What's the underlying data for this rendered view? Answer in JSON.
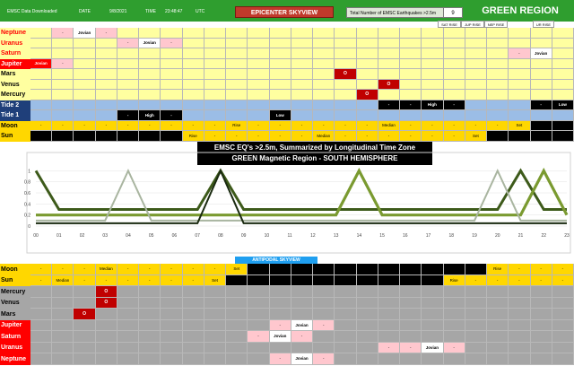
{
  "header": {
    "downloaded_label": "EMSC Data Downloaded",
    "date_label": "DATE",
    "date_value": "9/8/2021",
    "time_label": "TIME",
    "time_value": "23:48:47",
    "tz": "UTC",
    "epicenter_title": "EPICENTER SKYVIEW",
    "total_label": "Total Number of EMSC Earthquakes >2.5m",
    "total_value": "9",
    "region_title": "GREEN REGION",
    "rise_labels": [
      "SAT RISE",
      "JUP RISE",
      "NEP RISE",
      "UR RISE"
    ]
  },
  "epicenter_rows": [
    {
      "label": "Neptune",
      "label_color": "#ff0000",
      "bg": "#ffffa0",
      "label_bg": "#ffffa0",
      "cells": [
        {
          "i": 2,
          "t": "-",
          "k": "dash"
        },
        {
          "i": 3,
          "t": "Jovian",
          "k": "jov"
        },
        {
          "i": 4,
          "t": "-",
          "k": "dash"
        }
      ]
    },
    {
      "label": "Uranus",
      "label_color": "#ff0000",
      "bg": "#ffffa0",
      "label_bg": "#ffffa0",
      "cells": [
        {
          "i": 5,
          "t": "-",
          "k": "dash"
        },
        {
          "i": 6,
          "t": "Jovian",
          "k": "jov"
        },
        {
          "i": 7,
          "t": "-",
          "k": "dash"
        }
      ]
    },
    {
      "label": "Saturn",
      "label_color": "#ff0000",
      "bg": "#ffffa0",
      "label_bg": "#ffffa0",
      "cells": [
        {
          "i": 23,
          "t": "-",
          "k": "dash"
        },
        {
          "i": 24,
          "t": "Jovian",
          "k": "jov"
        }
      ]
    },
    {
      "label": "Jupiter",
      "label_color": "#ffffff",
      "bg": "#ffffa0",
      "label_bg": "#ff0000",
      "cells": [
        {
          "i": 1,
          "t": "Jovian",
          "k": "jov-red"
        },
        {
          "i": 2,
          "t": "-",
          "k": "dash"
        }
      ]
    },
    {
      "label": "Mars",
      "label_color": "#000000",
      "bg": "#ffffa0",
      "label_bg": "#ffffa0",
      "cells": [
        {
          "i": 15,
          "t": "O",
          "k": "o"
        }
      ]
    },
    {
      "label": "Venus",
      "label_color": "#000000",
      "bg": "#ffffa0",
      "label_bg": "#ffffa0",
      "cells": [
        {
          "i": 17,
          "t": "O",
          "k": "o"
        }
      ]
    },
    {
      "label": "Mercury",
      "label_color": "#000000",
      "bg": "#ffffa0",
      "label_bg": "#ffffa0",
      "cells": [
        {
          "i": 16,
          "t": "O",
          "k": "o"
        }
      ]
    },
    {
      "label": "Tide 2",
      "label_color": "#ffffff",
      "bg": "#9bbde6",
      "label_bg": "#1f3f7a",
      "cells": [
        {
          "i": 17,
          "t": "-",
          "k": "tide"
        },
        {
          "i": 18,
          "t": "-",
          "k": "tide"
        },
        {
          "i": 19,
          "t": "High",
          "k": "tide"
        },
        {
          "i": 20,
          "t": "-",
          "k": "tide"
        },
        {
          "i": 24,
          "t": "-",
          "k": "tide"
        },
        {
          "i": 25,
          "t": "Low",
          "k": "tide"
        }
      ]
    },
    {
      "label": "Tide 1",
      "label_color": "#ffffff",
      "bg": "#9bbde6",
      "label_bg": "#1f3f7a",
      "cells": [
        {
          "i": 5,
          "t": "-",
          "k": "tide"
        },
        {
          "i": 6,
          "t": "High",
          "k": "tide"
        },
        {
          "i": 7,
          "t": "-",
          "k": "tide"
        },
        {
          "i": 12,
          "t": "Low",
          "k": "tide"
        }
      ]
    },
    {
      "label": "Moon",
      "label_color": "#000000",
      "bg": "#000000",
      "label_bg": "#ffd700",
      "cells": [
        {
          "i": 1,
          "t": "-",
          "k": "ev"
        },
        {
          "i": 2,
          "t": "-",
          "k": "ev"
        },
        {
          "i": 3,
          "t": "-",
          "k": "ev"
        },
        {
          "i": 4,
          "t": "-",
          "k": "ev"
        },
        {
          "i": 5,
          "t": "-",
          "k": "ev"
        },
        {
          "i": 6,
          "t": "-",
          "k": "ev"
        },
        {
          "i": 7,
          "t": "-",
          "k": "ev"
        },
        {
          "i": 8,
          "t": "-",
          "k": "ev"
        },
        {
          "i": 9,
          "t": "-",
          "k": "ev"
        },
        {
          "i": 10,
          "t": "Rise",
          "k": "ev"
        },
        {
          "i": 11,
          "t": "-",
          "k": "ev"
        },
        {
          "i": 12,
          "t": "-",
          "k": "ev"
        },
        {
          "i": 13,
          "t": "-",
          "k": "ev"
        },
        {
          "i": 14,
          "t": "-",
          "k": "ev"
        },
        {
          "i": 15,
          "t": "-",
          "k": "ev"
        },
        {
          "i": 16,
          "t": "-",
          "k": "ev"
        },
        {
          "i": 17,
          "t": "Median",
          "k": "ev"
        },
        {
          "i": 18,
          "t": "-",
          "k": "ev"
        },
        {
          "i": 19,
          "t": "-",
          "k": "ev"
        },
        {
          "i": 20,
          "t": "-",
          "k": "ev"
        },
        {
          "i": 21,
          "t": "-",
          "k": "ev"
        },
        {
          "i": 22,
          "t": "-",
          "k": "ev"
        },
        {
          "i": 23,
          "t": "Set",
          "k": "ev"
        }
      ]
    },
    {
      "label": "Sun",
      "label_color": "#000000",
      "bg": "#000000",
      "label_bg": "#ffd700",
      "cells": [
        {
          "i": 8,
          "t": "Rise",
          "k": "ev"
        },
        {
          "i": 9,
          "t": "-",
          "k": "ev"
        },
        {
          "i": 10,
          "t": "-",
          "k": "ev"
        },
        {
          "i": 11,
          "t": "-",
          "k": "ev"
        },
        {
          "i": 12,
          "t": "-",
          "k": "ev"
        },
        {
          "i": 13,
          "t": "-",
          "k": "ev"
        },
        {
          "i": 14,
          "t": "Median",
          "k": "ev"
        },
        {
          "i": 15,
          "t": "-",
          "k": "ev"
        },
        {
          "i": 16,
          "t": "-",
          "k": "ev"
        },
        {
          "i": 17,
          "t": "-",
          "k": "ev"
        },
        {
          "i": 18,
          "t": "-",
          "k": "ev"
        },
        {
          "i": 19,
          "t": "-",
          "k": "ev"
        },
        {
          "i": 20,
          "t": "-",
          "k": "ev"
        },
        {
          "i": 21,
          "t": "Set",
          "k": "ev"
        }
      ]
    }
  ],
  "chart_data": {
    "type": "line",
    "title": "EMSC EQ's >2.5m, Summarized  by Longitudinal Time Zone",
    "subtitle": "GREEN Magnetic Region - SOUTH HEMISPHERE",
    "x": [
      "00",
      "01",
      "02",
      "03",
      "04",
      "05",
      "06",
      "07",
      "08",
      "09",
      "10",
      "11",
      "12",
      "13",
      "14",
      "15",
      "16",
      "17",
      "18",
      "19",
      "20",
      "21",
      "22",
      "23"
    ],
    "ylim": [
      0,
      1.2
    ],
    "yticks": [
      1,
      0.8,
      0.6,
      0.4,
      0.2,
      0
    ],
    "series": [
      {
        "color": "#3d5a1a",
        "values": [
          1,
          0.3,
          0.3,
          0.3,
          0.3,
          0.3,
          0.3,
          0.3,
          1,
          0.3,
          0.3,
          0.3,
          0.3,
          0.3,
          0.3,
          0.3,
          0.3,
          0.3,
          0.3,
          0.3,
          0.3,
          1,
          0.3,
          0.3
        ]
      },
      {
        "color": "#7a9a30",
        "values": [
          0.2,
          0.2,
          0.2,
          0.2,
          0.2,
          0.2,
          0.2,
          0.2,
          0.2,
          0.2,
          0.2,
          0.2,
          0.2,
          0.2,
          1,
          0.2,
          0.2,
          0.2,
          0.2,
          0.2,
          0.2,
          0.2,
          1,
          0.2
        ]
      },
      {
        "color": "#a9b5a0",
        "values": [
          0.1,
          0.1,
          0.1,
          0.1,
          1,
          0.1,
          0.1,
          0.1,
          0.1,
          0.1,
          0.1,
          0.1,
          0.1,
          0.1,
          0.1,
          0.1,
          0.1,
          0.1,
          0.1,
          0.1,
          1,
          0.1,
          0.1,
          0.1
        ]
      },
      {
        "color": "#1a2a10",
        "values": [
          0.05,
          0.05,
          0.05,
          0.05,
          0.05,
          0.05,
          0.05,
          0.05,
          1,
          0.05,
          0.05,
          0.05,
          0.05,
          0.05,
          0.05,
          0.05,
          0.05,
          0.05,
          0.05,
          0.05,
          0.05,
          0.05,
          0.05,
          0.05
        ]
      }
    ]
  },
  "antipodal": {
    "title": "ANTIPODAL SKYVIEW",
    "rows": [
      {
        "label": "Moon",
        "label_color": "#000000",
        "bg": "#000000",
        "label_bg": "#ffd700",
        "cells": [
          {
            "i": 1,
            "t": "-",
            "k": "ev"
          },
          {
            "i": 2,
            "t": "-",
            "k": "ev"
          },
          {
            "i": 3,
            "t": "-",
            "k": "ev"
          },
          {
            "i": 4,
            "t": "Median",
            "k": "ev"
          },
          {
            "i": 5,
            "t": "-",
            "k": "ev"
          },
          {
            "i": 6,
            "t": "-",
            "k": "ev"
          },
          {
            "i": 7,
            "t": "-",
            "k": "ev"
          },
          {
            "i": 8,
            "t": "-",
            "k": "ev"
          },
          {
            "i": 9,
            "t": "-",
            "k": "ev"
          },
          {
            "i": 10,
            "t": "Set",
            "k": "ev"
          },
          {
            "i": 22,
            "t": "Rise",
            "k": "ev"
          },
          {
            "i": 23,
            "t": "-",
            "k": "ev"
          },
          {
            "i": 24,
            "t": "-",
            "k": "ev"
          },
          {
            "i": 25,
            "t": "-",
            "k": "ev"
          }
        ]
      },
      {
        "label": "Sun",
        "label_color": "#000000",
        "bg": "#000000",
        "label_bg": "#ffd700",
        "cells": [
          {
            "i": 1,
            "t": "-",
            "k": "ev"
          },
          {
            "i": 2,
            "t": "Median",
            "k": "ev"
          },
          {
            "i": 3,
            "t": "-",
            "k": "ev"
          },
          {
            "i": 4,
            "t": "-",
            "k": "ev"
          },
          {
            "i": 5,
            "t": "-",
            "k": "ev"
          },
          {
            "i": 6,
            "t": "-",
            "k": "ev"
          },
          {
            "i": 7,
            "t": "-",
            "k": "ev"
          },
          {
            "i": 8,
            "t": "-",
            "k": "ev"
          },
          {
            "i": 9,
            "t": "Set",
            "k": "ev"
          },
          {
            "i": 20,
            "t": "Rise",
            "k": "ev"
          },
          {
            "i": 21,
            "t": "-",
            "k": "ev"
          },
          {
            "i": 22,
            "t": "-",
            "k": "ev"
          },
          {
            "i": 23,
            "t": "-",
            "k": "ev"
          },
          {
            "i": 24,
            "t": "-",
            "k": "ev"
          },
          {
            "i": 25,
            "t": "-",
            "k": "ev"
          }
        ]
      },
      {
        "label": "Mercury",
        "label_color": "#000000",
        "bg": "#a6a6a6",
        "label_bg": "#a6a6a6",
        "cells": [
          {
            "i": 4,
            "t": "O",
            "k": "o"
          }
        ]
      },
      {
        "label": "Venus",
        "label_color": "#000000",
        "bg": "#a6a6a6",
        "label_bg": "#a6a6a6",
        "cells": [
          {
            "i": 4,
            "t": "O",
            "k": "o"
          }
        ]
      },
      {
        "label": "Mars",
        "label_color": "#000000",
        "bg": "#a6a6a6",
        "label_bg": "#a6a6a6",
        "cells": [
          {
            "i": 3,
            "t": "O",
            "k": "o"
          }
        ]
      },
      {
        "label": "Jupiter",
        "label_color": "#ffffff",
        "bg": "#a6a6a6",
        "label_bg": "#ff0000",
        "cells": [
          {
            "i": 12,
            "t": "-",
            "k": "dash"
          },
          {
            "i": 13,
            "t": "Jovian",
            "k": "jov"
          },
          {
            "i": 14,
            "t": "-",
            "k": "dash"
          }
        ]
      },
      {
        "label": "Saturn",
        "label_color": "#ffffff",
        "bg": "#a6a6a6",
        "label_bg": "#ff0000",
        "cells": [
          {
            "i": 11,
            "t": "-",
            "k": "dash"
          },
          {
            "i": 12,
            "t": "Jovian",
            "k": "jov"
          },
          {
            "i": 13,
            "t": "-",
            "k": "dash"
          }
        ]
      },
      {
        "label": "Uranus",
        "label_color": "#ffffff",
        "bg": "#a6a6a6",
        "label_bg": "#ff0000",
        "cells": [
          {
            "i": 17,
            "t": "-",
            "k": "dash"
          },
          {
            "i": 18,
            "t": "-",
            "k": "dash"
          },
          {
            "i": 19,
            "t": "Jovian",
            "k": "jov"
          },
          {
            "i": 20,
            "t": "-",
            "k": "dash"
          }
        ]
      },
      {
        "label": "Neptune",
        "label_color": "#ffffff",
        "bg": "#a6a6a6",
        "label_bg": "#ff0000",
        "cells": [
          {
            "i": 12,
            "t": "-",
            "k": "dash"
          },
          {
            "i": 13,
            "t": "Jovian",
            "k": "jov"
          },
          {
            "i": 14,
            "t": "-",
            "k": "dash"
          }
        ]
      }
    ]
  }
}
